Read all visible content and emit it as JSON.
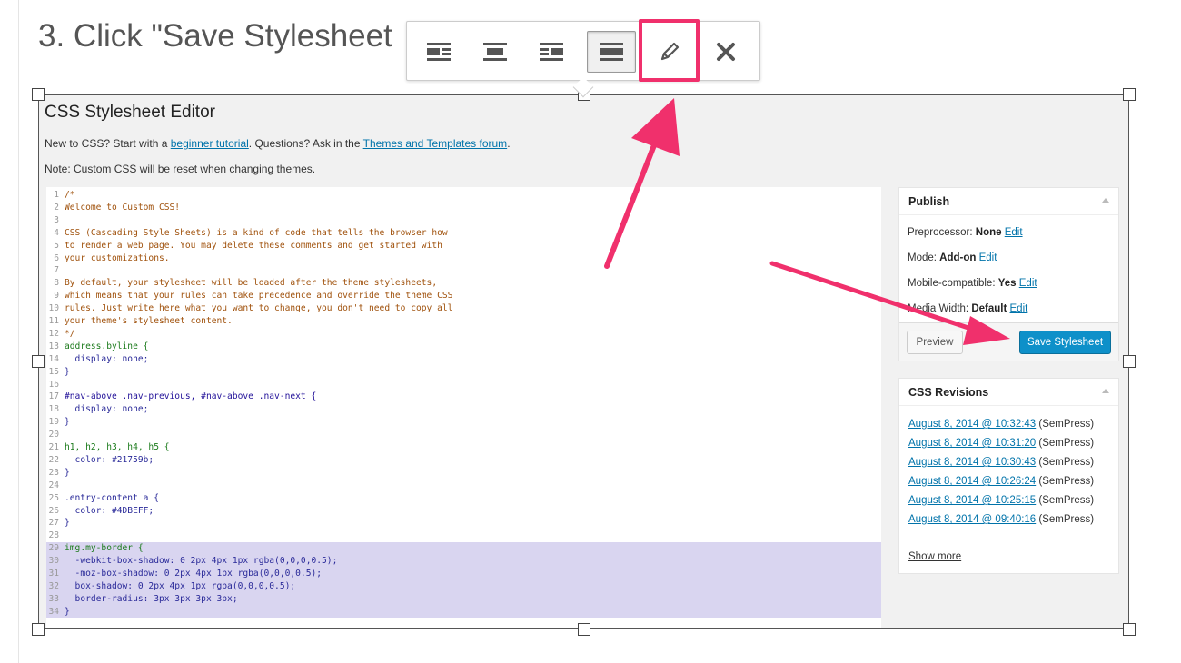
{
  "heading": "3. Click \"Save Stylesheet",
  "toolbar": {
    "buttons": [
      "align-left-icon",
      "align-center-icon",
      "align-right-icon",
      "align-none-icon",
      "edit-pencil-icon",
      "remove-x-icon"
    ],
    "active": "align-none-icon",
    "highlighted": "edit-pencil-icon"
  },
  "editor": {
    "title": "CSS Stylesheet Editor",
    "intro_prefix": "New to CSS? Start with a ",
    "intro_link1": "beginner tutorial",
    "intro_mid": ". Questions? Ask in the ",
    "intro_link2": "Themes and Templates forum",
    "intro_suffix": ".",
    "note": "Note: Custom CSS will be reset when changing themes."
  },
  "code_lines": [
    {
      "n": "1",
      "t": "/*",
      "c": "c-com"
    },
    {
      "n": "2",
      "t": "Welcome to Custom CSS!",
      "c": "c-com"
    },
    {
      "n": "3",
      "t": "",
      "c": "c-com"
    },
    {
      "n": "4",
      "t": "CSS (Cascading Style Sheets) is a kind of code that tells the browser how",
      "c": "c-com"
    },
    {
      "n": "5",
      "t": "to render a web page. You may delete these comments and get started with",
      "c": "c-com"
    },
    {
      "n": "6",
      "t": "your customizations.",
      "c": "c-com"
    },
    {
      "n": "7",
      "t": "",
      "c": "c-com"
    },
    {
      "n": "8",
      "t": "By default, your stylesheet will be loaded after the theme stylesheets,",
      "c": "c-com"
    },
    {
      "n": "9",
      "t": "which means that your rules can take precedence and override the theme CSS",
      "c": "c-com"
    },
    {
      "n": "10",
      "t": "rules. Just write here what you want to change, you don't need to copy all",
      "c": "c-com"
    },
    {
      "n": "11",
      "t": "your theme's stylesheet content.",
      "c": "c-com"
    },
    {
      "n": "12",
      "t": "*/",
      "c": "c-com"
    },
    {
      "n": "13",
      "t": "address.byline {",
      "c": "c-kw"
    },
    {
      "n": "14",
      "t": "  display: none;",
      "c": "c-val"
    },
    {
      "n": "15",
      "t": "}",
      "c": "c-val"
    },
    {
      "n": "16",
      "t": "",
      "c": "c-val"
    },
    {
      "n": "17",
      "t": "#nav-above .nav-previous, #nav-above .nav-next {",
      "c": "c-id"
    },
    {
      "n": "18",
      "t": "  display: none;",
      "c": "c-val"
    },
    {
      "n": "19",
      "t": "}",
      "c": "c-val"
    },
    {
      "n": "20",
      "t": "",
      "c": "c-val"
    },
    {
      "n": "21",
      "t": "h1, h2, h3, h4, h5 {",
      "c": "c-kw"
    },
    {
      "n": "22",
      "t": "  color: #21759b;",
      "c": "c-val"
    },
    {
      "n": "23",
      "t": "}",
      "c": "c-val"
    },
    {
      "n": "24",
      "t": "",
      "c": "c-val"
    },
    {
      "n": "25",
      "t": ".entry-content a {",
      "c": "c-val"
    },
    {
      "n": "26",
      "t": "  color: #4DBEFF;",
      "c": "c-val"
    },
    {
      "n": "27",
      "t": "}",
      "c": "c-val"
    },
    {
      "n": "28",
      "t": "",
      "c": "c-val"
    },
    {
      "n": "29",
      "t": "img.my-border {",
      "c": "c-kw"
    },
    {
      "n": "30",
      "t": "  -webkit-box-shadow: 0 2px 4px 1px rgba(0,0,0,0.5);",
      "c": "c-val"
    },
    {
      "n": "31",
      "t": "  -moz-box-shadow: 0 2px 4px 1px rgba(0,0,0,0.5);",
      "c": "c-val"
    },
    {
      "n": "32",
      "t": "  box-shadow: 0 2px 4px 1px rgba(0,0,0,0.5);",
      "c": "c-val"
    },
    {
      "n": "33",
      "t": "  border-radius: 3px 3px 3px 3px;",
      "c": "c-val"
    },
    {
      "n": "34",
      "t": "}",
      "c": "c-val"
    }
  ],
  "highlight_lines": [
    "29",
    "30",
    "31",
    "32",
    "33",
    "34"
  ],
  "publish": {
    "title": "Publish",
    "preprocessor_label": "Preprocessor: ",
    "preprocessor_value": "None",
    "mode_label": "Mode: ",
    "mode_value": "Add-on",
    "mobile_label": "Mobile-compatible: ",
    "mobile_value": "Yes",
    "media_label": "Media Width: ",
    "media_value": "Default",
    "edit": "Edit",
    "preview": "Preview",
    "save": "Save Stylesheet"
  },
  "revisions": {
    "title": "CSS Revisions",
    "items": [
      {
        "date": "August 8, 2014 @ 10:32:43",
        "by": " (SemPress)"
      },
      {
        "date": "August 8, 2014 @ 10:31:20",
        "by": " (SemPress)"
      },
      {
        "date": "August 8, 2014 @ 10:30:43",
        "by": " (SemPress)"
      },
      {
        "date": "August 8, 2014 @ 10:26:24",
        "by": " (SemPress)"
      },
      {
        "date": "August 8, 2014 @ 10:25:15",
        "by": " (SemPress)"
      },
      {
        "date": "August 8, 2014 @ 09:40:16",
        "by": " (SemPress)"
      }
    ],
    "show_more": "Show more"
  },
  "colors": {
    "annotation": "#f0306c",
    "save_button": "#0e90c9",
    "link": "#0073aa",
    "selection": "#d9d5f0"
  }
}
